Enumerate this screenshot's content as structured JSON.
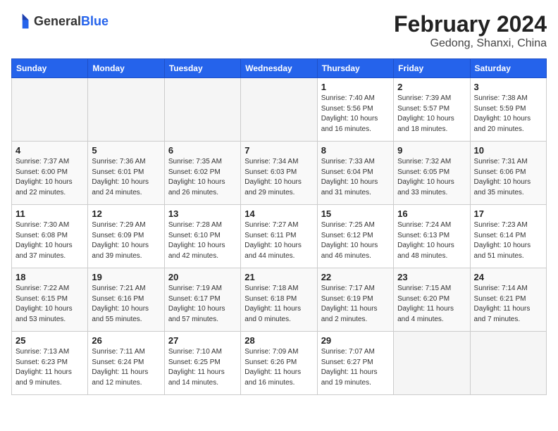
{
  "logo": {
    "text_general": "General",
    "text_blue": "Blue"
  },
  "title": "February 2024",
  "subtitle": "Gedong, Shanxi, China",
  "weekdays": [
    "Sunday",
    "Monday",
    "Tuesday",
    "Wednesday",
    "Thursday",
    "Friday",
    "Saturday"
  ],
  "weeks": [
    [
      {
        "day": "",
        "info": ""
      },
      {
        "day": "",
        "info": ""
      },
      {
        "day": "",
        "info": ""
      },
      {
        "day": "",
        "info": ""
      },
      {
        "day": "1",
        "info": "Sunrise: 7:40 AM\nSunset: 5:56 PM\nDaylight: 10 hours\nand 16 minutes."
      },
      {
        "day": "2",
        "info": "Sunrise: 7:39 AM\nSunset: 5:57 PM\nDaylight: 10 hours\nand 18 minutes."
      },
      {
        "day": "3",
        "info": "Sunrise: 7:38 AM\nSunset: 5:59 PM\nDaylight: 10 hours\nand 20 minutes."
      }
    ],
    [
      {
        "day": "4",
        "info": "Sunrise: 7:37 AM\nSunset: 6:00 PM\nDaylight: 10 hours\nand 22 minutes."
      },
      {
        "day": "5",
        "info": "Sunrise: 7:36 AM\nSunset: 6:01 PM\nDaylight: 10 hours\nand 24 minutes."
      },
      {
        "day": "6",
        "info": "Sunrise: 7:35 AM\nSunset: 6:02 PM\nDaylight: 10 hours\nand 26 minutes."
      },
      {
        "day": "7",
        "info": "Sunrise: 7:34 AM\nSunset: 6:03 PM\nDaylight: 10 hours\nand 29 minutes."
      },
      {
        "day": "8",
        "info": "Sunrise: 7:33 AM\nSunset: 6:04 PM\nDaylight: 10 hours\nand 31 minutes."
      },
      {
        "day": "9",
        "info": "Sunrise: 7:32 AM\nSunset: 6:05 PM\nDaylight: 10 hours\nand 33 minutes."
      },
      {
        "day": "10",
        "info": "Sunrise: 7:31 AM\nSunset: 6:06 PM\nDaylight: 10 hours\nand 35 minutes."
      }
    ],
    [
      {
        "day": "11",
        "info": "Sunrise: 7:30 AM\nSunset: 6:08 PM\nDaylight: 10 hours\nand 37 minutes."
      },
      {
        "day": "12",
        "info": "Sunrise: 7:29 AM\nSunset: 6:09 PM\nDaylight: 10 hours\nand 39 minutes."
      },
      {
        "day": "13",
        "info": "Sunrise: 7:28 AM\nSunset: 6:10 PM\nDaylight: 10 hours\nand 42 minutes."
      },
      {
        "day": "14",
        "info": "Sunrise: 7:27 AM\nSunset: 6:11 PM\nDaylight: 10 hours\nand 44 minutes."
      },
      {
        "day": "15",
        "info": "Sunrise: 7:25 AM\nSunset: 6:12 PM\nDaylight: 10 hours\nand 46 minutes."
      },
      {
        "day": "16",
        "info": "Sunrise: 7:24 AM\nSunset: 6:13 PM\nDaylight: 10 hours\nand 48 minutes."
      },
      {
        "day": "17",
        "info": "Sunrise: 7:23 AM\nSunset: 6:14 PM\nDaylight: 10 hours\nand 51 minutes."
      }
    ],
    [
      {
        "day": "18",
        "info": "Sunrise: 7:22 AM\nSunset: 6:15 PM\nDaylight: 10 hours\nand 53 minutes."
      },
      {
        "day": "19",
        "info": "Sunrise: 7:21 AM\nSunset: 6:16 PM\nDaylight: 10 hours\nand 55 minutes."
      },
      {
        "day": "20",
        "info": "Sunrise: 7:19 AM\nSunset: 6:17 PM\nDaylight: 10 hours\nand 57 minutes."
      },
      {
        "day": "21",
        "info": "Sunrise: 7:18 AM\nSunset: 6:18 PM\nDaylight: 11 hours\nand 0 minutes."
      },
      {
        "day": "22",
        "info": "Sunrise: 7:17 AM\nSunset: 6:19 PM\nDaylight: 11 hours\nand 2 minutes."
      },
      {
        "day": "23",
        "info": "Sunrise: 7:15 AM\nSunset: 6:20 PM\nDaylight: 11 hours\nand 4 minutes."
      },
      {
        "day": "24",
        "info": "Sunrise: 7:14 AM\nSunset: 6:21 PM\nDaylight: 11 hours\nand 7 minutes."
      }
    ],
    [
      {
        "day": "25",
        "info": "Sunrise: 7:13 AM\nSunset: 6:23 PM\nDaylight: 11 hours\nand 9 minutes."
      },
      {
        "day": "26",
        "info": "Sunrise: 7:11 AM\nSunset: 6:24 PM\nDaylight: 11 hours\nand 12 minutes."
      },
      {
        "day": "27",
        "info": "Sunrise: 7:10 AM\nSunset: 6:25 PM\nDaylight: 11 hours\nand 14 minutes."
      },
      {
        "day": "28",
        "info": "Sunrise: 7:09 AM\nSunset: 6:26 PM\nDaylight: 11 hours\nand 16 minutes."
      },
      {
        "day": "29",
        "info": "Sunrise: 7:07 AM\nSunset: 6:27 PM\nDaylight: 11 hours\nand 19 minutes."
      },
      {
        "day": "",
        "info": ""
      },
      {
        "day": "",
        "info": ""
      }
    ]
  ]
}
